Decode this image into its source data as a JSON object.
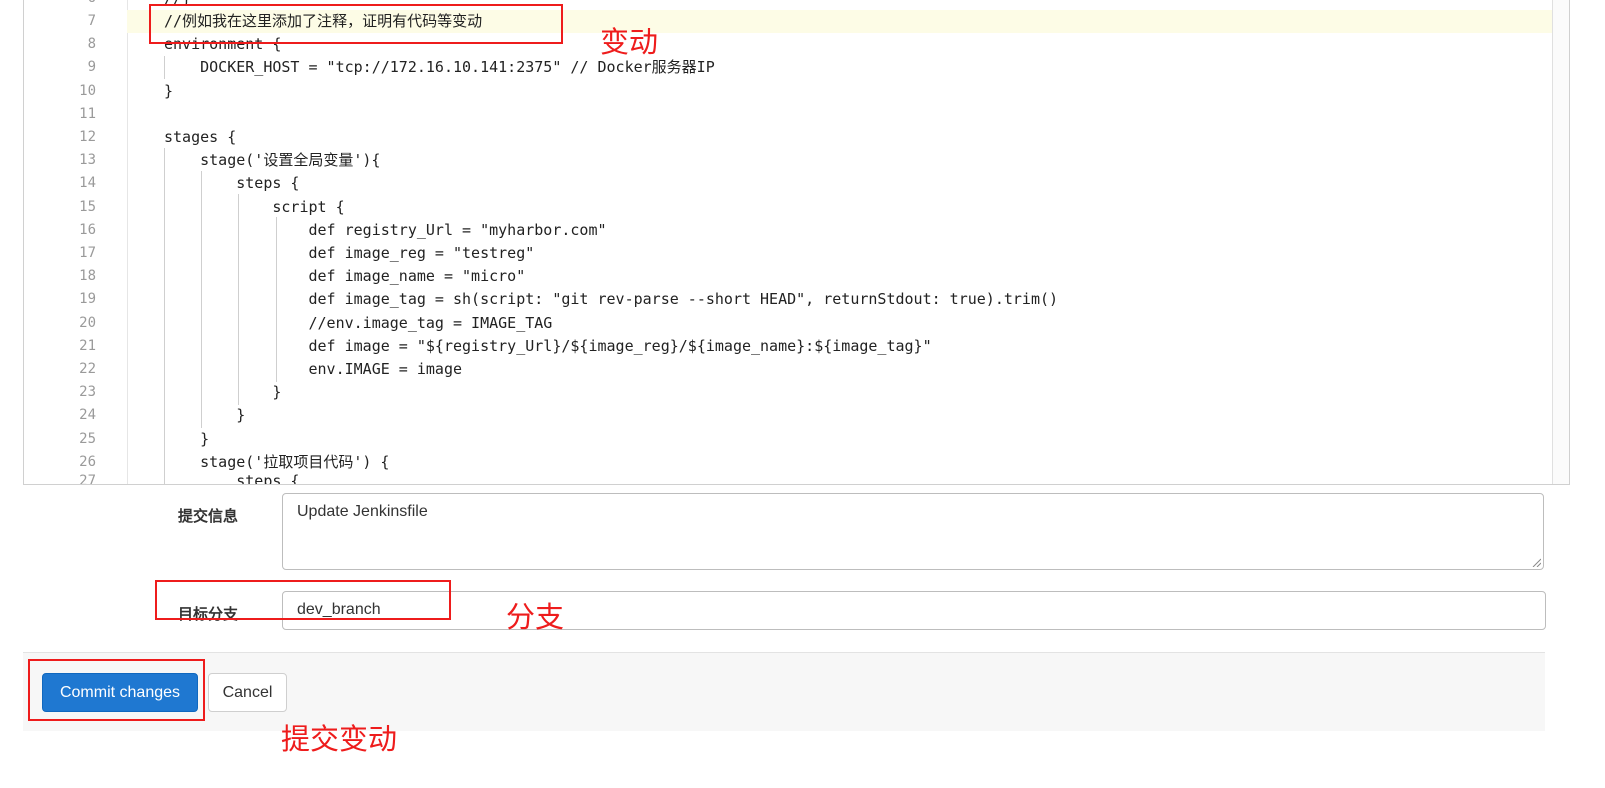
{
  "editor": {
    "lines": [
      {
        "n": "7",
        "text": "//例如我在这里添加了注释，证明有代码等变动"
      },
      {
        "n": "8",
        "text": "environment {"
      },
      {
        "n": "9",
        "text": "    DOCKER_HOST = \"tcp://172.16.10.141:2375\" // Docker服务器IP"
      },
      {
        "n": "10",
        "text": "}"
      },
      {
        "n": "11",
        "text": ""
      },
      {
        "n": "12",
        "text": "stages {"
      },
      {
        "n": "13",
        "text": "    stage('设置全局变量'){"
      },
      {
        "n": "14",
        "text": "        steps {"
      },
      {
        "n": "15",
        "text": "            script {"
      },
      {
        "n": "16",
        "text": "                def registry_Url = \"myharbor.com\""
      },
      {
        "n": "17",
        "text": "                def image_reg = \"testreg\""
      },
      {
        "n": "18",
        "text": "                def image_name = \"micro\""
      },
      {
        "n": "19",
        "text": "                def image_tag = sh(script: \"git rev-parse --short HEAD\", returnStdout: true).trim()"
      },
      {
        "n": "20",
        "text": "                //env.image_tag = IMAGE_TAG"
      },
      {
        "n": "21",
        "text": "                def image = \"${registry_Url}/${image_reg}/${image_name}:${image_tag}\""
      },
      {
        "n": "22",
        "text": "                env.IMAGE = image"
      },
      {
        "n": "23",
        "text": "            }"
      },
      {
        "n": "24",
        "text": "        }"
      },
      {
        "n": "25",
        "text": "    }"
      },
      {
        "n": "26",
        "text": "    stage('拉取项目代码') {"
      }
    ]
  },
  "form": {
    "commit_message_label": "提交信息",
    "commit_message_value": "Update Jenkinsfile",
    "target_branch_label": "目标分支",
    "target_branch_value": "dev_branch"
  },
  "buttons": {
    "commit": "Commit changes",
    "cancel": "Cancel"
  },
  "annotations": {
    "change": "变动",
    "branch": "分支",
    "commit": "提交变动"
  },
  "colors": {
    "annotation": "#ee1c1c",
    "primary_button": "#1f78d1",
    "highlight_line": "#fdfce6"
  }
}
